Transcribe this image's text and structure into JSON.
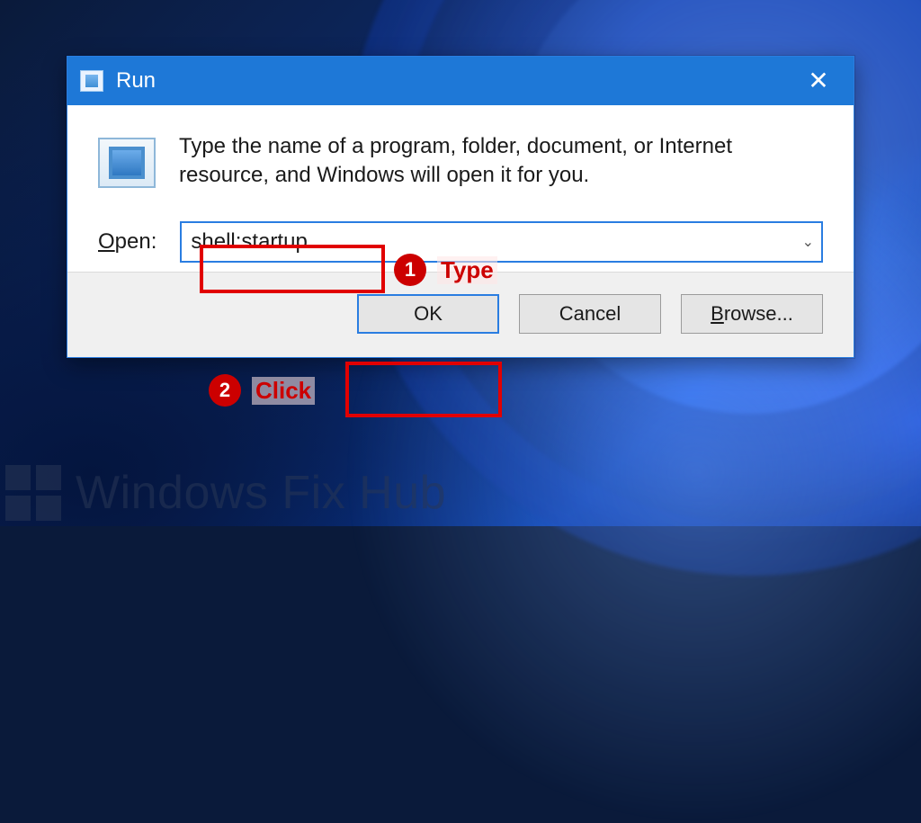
{
  "titlebar": {
    "title": "Run",
    "close_tooltip": "Close"
  },
  "dialog": {
    "description": "Type the name of a program, folder, document, or Internet resource, and Windows will open it for you.",
    "open_label_prefix": "O",
    "open_label_rest": "pen:",
    "open_value": "shell:startup",
    "open_placeholder": ""
  },
  "buttons": {
    "ok": "OK",
    "cancel": "Cancel",
    "browse_prefix": "B",
    "browse_rest": "rowse..."
  },
  "annotations": {
    "step1_num": "1",
    "step1_label": "Type",
    "step2_num": "2",
    "step2_label": "Click"
  },
  "watermark": {
    "text": "Windows Fix Hub"
  }
}
